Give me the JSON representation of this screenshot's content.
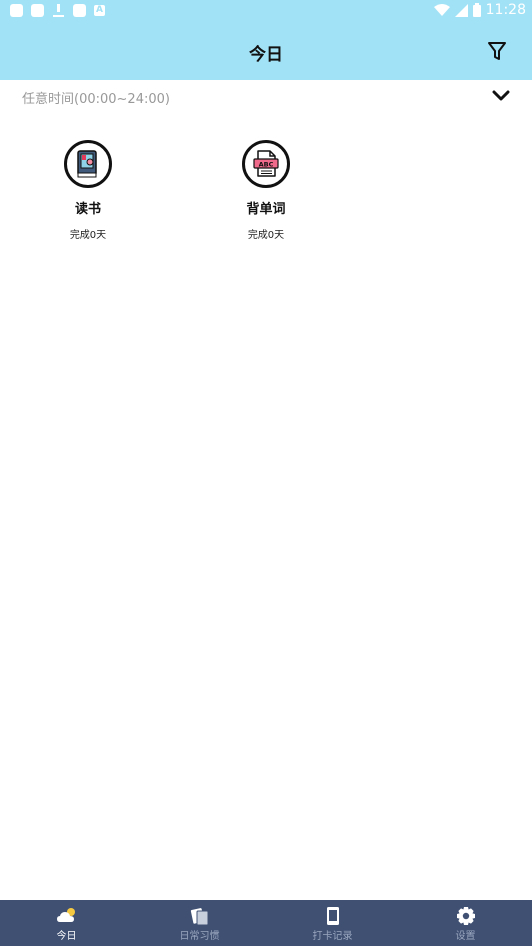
{
  "status_bar": {
    "time": "11:28"
  },
  "header": {
    "title": "今日"
  },
  "time_filter": {
    "label": "任意时间(00:00~24:00)"
  },
  "habits": [
    {
      "name": "读书",
      "status": "完成0天",
      "icon": "book-icon"
    },
    {
      "name": "背单词",
      "status": "完成0天",
      "icon": "abc-file-icon"
    }
  ],
  "bottom_nav": {
    "items": [
      {
        "label": "今日",
        "icon": "cloud-sun-icon",
        "active": true
      },
      {
        "label": "日常习惯",
        "icon": "cards-icon",
        "active": false
      },
      {
        "label": "打卡记录",
        "icon": "tablet-icon",
        "active": false
      },
      {
        "label": "设置",
        "icon": "gear-icon",
        "active": false
      }
    ]
  },
  "colors": {
    "header_bg": "#a2e2f6",
    "nav_bg": "#3f5073"
  }
}
